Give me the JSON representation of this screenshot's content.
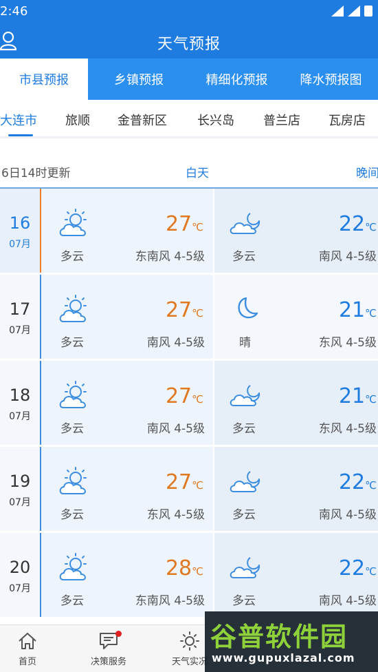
{
  "status": {
    "time": "2:46"
  },
  "header": {
    "title": "天气预报"
  },
  "tabs": [
    "市县预报",
    "乡镇预报",
    "精细化预报",
    "降水预报图"
  ],
  "districts": [
    "大连市",
    "旅顺",
    "金普新区",
    "长兴岛",
    "普兰店",
    "瓦房店"
  ],
  "update": {
    "text": "6日14时更新",
    "day_label": "白天",
    "night_label": "晚间"
  },
  "temp_unit": "℃",
  "colors": {
    "primary": "#1e7ce0",
    "tab_bar": "#2b8ff0",
    "day_temp": "#e07820",
    "night_temp": "#1e7ce0",
    "today_marker": "#ee7d2e"
  },
  "forecast": [
    {
      "day": "16",
      "month": "07月",
      "day_icon": "partly-cloudy-day-icon",
      "day_temp": "27",
      "day_cond": "多云",
      "day_wind": "东南风  4-5级",
      "night_icon": "partly-cloudy-night-icon",
      "night_temp": "22",
      "night_cond": "多云",
      "night_wind": "南风  4-5级"
    },
    {
      "day": "17",
      "month": "07月",
      "day_icon": "partly-cloudy-day-icon",
      "day_temp": "27",
      "day_cond": "多云",
      "day_wind": "南风  4-5级",
      "night_icon": "moon-icon",
      "night_temp": "21",
      "night_cond": "晴",
      "night_wind": "东风  4-5级"
    },
    {
      "day": "18",
      "month": "07月",
      "day_icon": "partly-cloudy-day-icon",
      "day_temp": "27",
      "day_cond": "多云",
      "day_wind": "南风  4-5级",
      "night_icon": "partly-cloudy-night-icon",
      "night_temp": "21",
      "night_cond": "多云",
      "night_wind": "东风  4-5级"
    },
    {
      "day": "19",
      "month": "07月",
      "day_icon": "partly-cloudy-day-icon",
      "day_temp": "27",
      "day_cond": "多云",
      "day_wind": "东风  4-5级",
      "night_icon": "partly-cloudy-night-icon",
      "night_temp": "22",
      "night_cond": "多云",
      "night_wind": "南风  4-5级"
    },
    {
      "day": "20",
      "month": "07月",
      "day_icon": "partly-cloudy-day-icon",
      "day_temp": "28",
      "day_cond": "多云",
      "day_wind": "东南风  4-5级",
      "night_icon": "partly-cloudy-night-icon",
      "night_temp": "22",
      "night_cond": "多云",
      "night_wind": "南风  4-5级"
    }
  ],
  "bottom_nav": [
    {
      "label": "首页",
      "icon": "home-icon"
    },
    {
      "label": "决策服务",
      "icon": "message-icon"
    },
    {
      "label": "天气实况",
      "icon": "sun-icon"
    }
  ],
  "watermark": {
    "title": "谷普软件园",
    "url": "www.gupuxlazal.com"
  }
}
